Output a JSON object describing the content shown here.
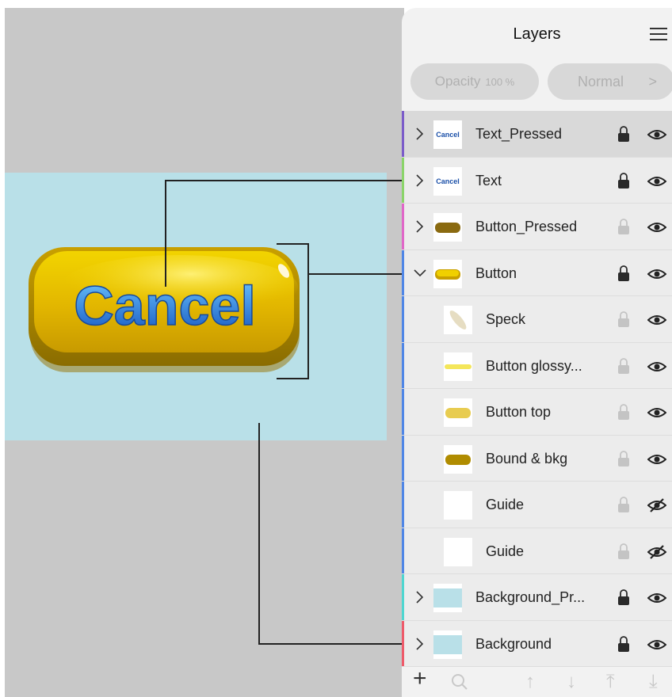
{
  "panel": {
    "title": "Layers",
    "opacity_label": "Opacity",
    "opacity_value": "100 %",
    "blend_mode": "Normal"
  },
  "canvas": {
    "button_text": "Cancel"
  },
  "colors": {
    "canvas_bg": "#c8c8c8",
    "artboard_bg": "#b9e0e8",
    "button_yellow": "#e0b400",
    "text_blue": "#1f6fd0"
  },
  "layers": [
    {
      "name": "Text_Pressed",
      "disclosure": "collapsed",
      "locked": true,
      "visible": true,
      "thumb": "text",
      "thumb_text": "Cancel",
      "bar_color": "#7b5cc9",
      "selected": true,
      "indent": false
    },
    {
      "name": "Text",
      "disclosure": "collapsed",
      "locked": true,
      "visible": true,
      "thumb": "text",
      "thumb_text": "Cancel",
      "bar_color": "#8bd46a",
      "selected": false,
      "indent": false
    },
    {
      "name": "Button_Pressed",
      "disclosure": "collapsed",
      "locked": false,
      "visible": true,
      "thumb": "pill-dark",
      "bar_color": "#e067c8",
      "selected": false,
      "indent": false
    },
    {
      "name": "Button",
      "disclosure": "expanded",
      "locked": true,
      "visible": true,
      "thumb": "pill-yellow",
      "bar_color": "#4f86e6",
      "selected": false,
      "indent": false
    },
    {
      "name": "Speck",
      "disclosure": "none",
      "locked": false,
      "visible": true,
      "thumb": "speck",
      "bar_color": "#4f86e6",
      "selected": false,
      "indent": true
    },
    {
      "name": "Button glossy...",
      "disclosure": "none",
      "locked": false,
      "visible": true,
      "thumb": "glossy",
      "bar_color": "#4f86e6",
      "selected": false,
      "indent": true
    },
    {
      "name": "Button top",
      "disclosure": "none",
      "locked": false,
      "visible": true,
      "thumb": "pill-light",
      "bar_color": "#4f86e6",
      "selected": false,
      "indent": true
    },
    {
      "name": "Bound & bkg",
      "disclosure": "none",
      "locked": false,
      "visible": true,
      "thumb": "pill-gold",
      "bar_color": "#4f86e6",
      "selected": false,
      "indent": true
    },
    {
      "name": "Guide",
      "disclosure": "none",
      "locked": false,
      "visible": false,
      "thumb": "blank",
      "bar_color": "#4f86e6",
      "selected": false,
      "indent": true
    },
    {
      "name": "Guide",
      "disclosure": "none",
      "locked": false,
      "visible": false,
      "thumb": "blank",
      "bar_color": "#4f86e6",
      "selected": false,
      "indent": true
    },
    {
      "name": "Background_Pr...",
      "disclosure": "collapsed",
      "locked": true,
      "visible": true,
      "thumb": "bg",
      "bar_color": "#4fd6d0",
      "selected": false,
      "indent": false
    },
    {
      "name": "Background",
      "disclosure": "collapsed",
      "locked": true,
      "visible": true,
      "thumb": "bg",
      "bar_color": "#ee5a6a",
      "selected": false,
      "indent": false
    }
  ],
  "toolbar": {
    "icons": [
      "plus-icon",
      "search-icon",
      "move-up-icon",
      "move-down-icon",
      "move-top-icon",
      "move-bottom-icon"
    ]
  }
}
